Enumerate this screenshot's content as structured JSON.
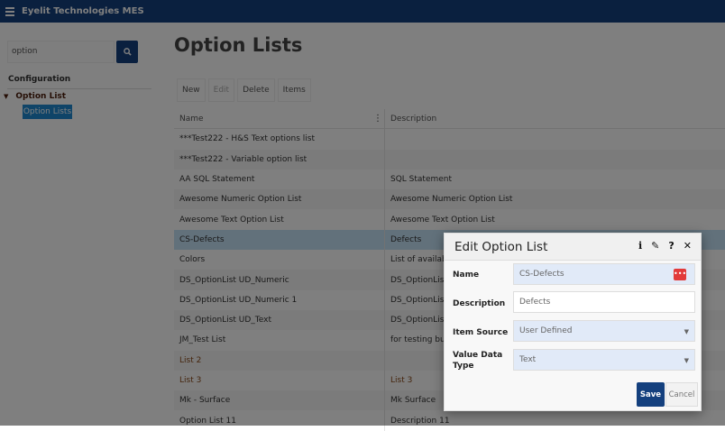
{
  "app": {
    "title": "Eyelit Technologies MES"
  },
  "sidebar": {
    "search_value": "option",
    "section": "Configuration",
    "group": "Option List",
    "active_item": "Option Lists"
  },
  "page": {
    "title": "Option Lists"
  },
  "toolbar": {
    "new": "New",
    "edit": "Edit",
    "delete": "Delete",
    "items": "Items"
  },
  "table": {
    "columns": [
      "Name",
      "Description"
    ],
    "rows": [
      {
        "name": "***Test222 - H&S Text options list",
        "desc": ""
      },
      {
        "name": "***Test222 - Variable option list",
        "desc": ""
      },
      {
        "name": "AA SQL Statement",
        "desc": "SQL Statement"
      },
      {
        "name": "Awesome Numeric Option List",
        "desc": "Awesome Numeric Option List"
      },
      {
        "name": "Awesome Text Option List",
        "desc": "Awesome Text Option List"
      },
      {
        "name": "CS-Defects",
        "desc": "Defects",
        "selected": true
      },
      {
        "name": "Colors",
        "desc": "List of available"
      },
      {
        "name": "DS_OptionList UD_Numeric",
        "desc": "DS_OptionList D"
      },
      {
        "name": "DS_OptionList UD_Numeric 1",
        "desc": "DS_OptionList D"
      },
      {
        "name": "DS_OptionList UD_Text",
        "desc": "DS_OptionList U"
      },
      {
        "name": "JM_Test List",
        "desc": "for testing bug"
      },
      {
        "name": "List 2",
        "desc": "",
        "brown": true
      },
      {
        "name": "List 3",
        "desc": "List 3",
        "brown": true
      },
      {
        "name": "Mk - Surface",
        "desc": "Mk Surface"
      },
      {
        "name": "Option List 11",
        "desc": "Description 11"
      }
    ]
  },
  "dialog": {
    "title": "Edit Option List",
    "fields": {
      "name_label": "Name",
      "name_value": "CS-Defects",
      "description_label": "Description",
      "description_value": "Defects",
      "item_source_label": "Item Source",
      "item_source_value": "User Defined",
      "value_type_label": "Value Data Type",
      "value_type_value": "Text"
    },
    "save": "Save",
    "cancel": "Cancel"
  },
  "colors": {
    "brand": "#14407e",
    "selected_row": "#c5e2f7",
    "active_item": "#1e88d0",
    "alert": "#e23a3a"
  }
}
